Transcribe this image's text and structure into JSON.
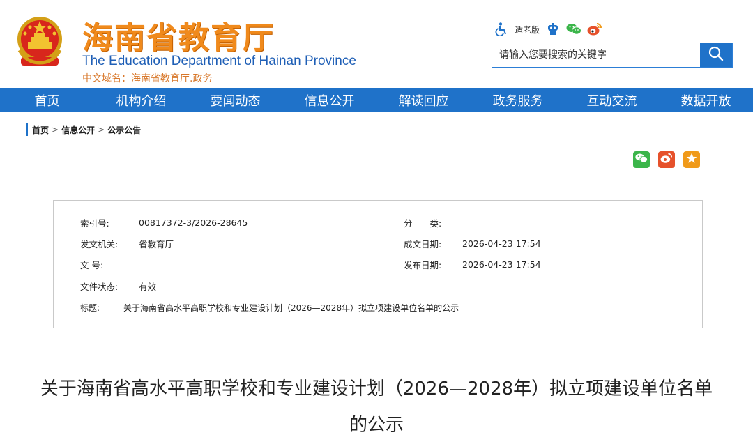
{
  "header": {
    "title": "海南省教育厅",
    "subtitle_en": "The Education Department of Hainan Province",
    "domain": "中文域名：海南省教育厅.政务"
  },
  "tools": {
    "elder_mode_label": "适老版"
  },
  "search": {
    "placeholder": "请输入您要搜索的关键字"
  },
  "nav": {
    "items": [
      {
        "label": "首页"
      },
      {
        "label": "机构介绍"
      },
      {
        "label": "要闻动态"
      },
      {
        "label": "信息公开"
      },
      {
        "label": "解读回应"
      },
      {
        "label": "政务服务"
      },
      {
        "label": "互动交流"
      },
      {
        "label": "数据开放"
      }
    ]
  },
  "breadcrumb": {
    "items": [
      "首页",
      "信息公开",
      "公示公告"
    ],
    "separator": ">"
  },
  "meta": {
    "index_label": "索引号:",
    "index_value": "00817372-3/2026-28645",
    "category_label": "分　　类:",
    "category_value": "",
    "issuer_label": "发文机关:",
    "issuer_value": "省教育厅",
    "created_label": "成文日期:",
    "created_value": "2026-04-23 17:54",
    "docno_label": "文  号:",
    "docno_value": "",
    "published_label": "发布日期:",
    "published_value": "2026-04-23 17:54",
    "status_label": "文件状态:",
    "status_value": "有效",
    "title_label": "标题:",
    "title_value": "关于海南省高水平高职学校和专业建设计划（2026—2028年）拟立项建设单位名单的公示"
  },
  "article": {
    "title": "关于海南省高水平高职学校和专业建设计划（2026—2028年）拟立项建设单位名单的公示"
  },
  "colors": {
    "brand_blue": "#1f72c9",
    "title_orange": "#f08a1c",
    "wechat_green": "#3bb54a",
    "weibo_red": "#e6512b",
    "star_orange": "#f09a1a"
  },
  "icons": {
    "emblem": "national-emblem-icon",
    "accessibility": "wheelchair-icon",
    "robot": "robot-icon",
    "wechat": "wechat-icon",
    "weibo": "weibo-icon",
    "search": "search-icon",
    "favorite": "star-icon"
  }
}
